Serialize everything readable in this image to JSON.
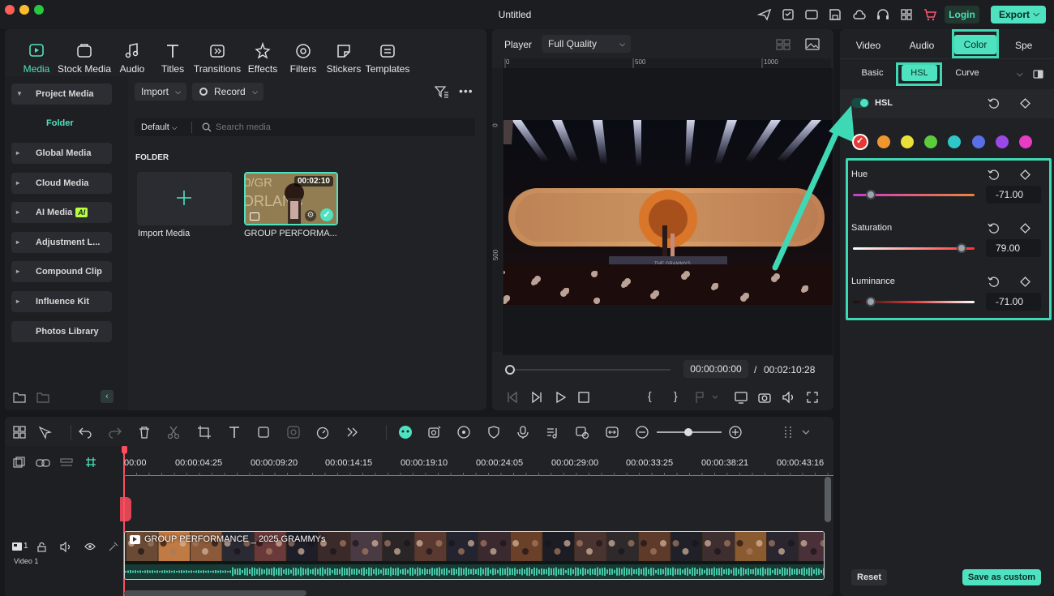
{
  "window": {
    "title": "Untitled",
    "login_label": "Login",
    "export_label": "Export"
  },
  "media_tabs": [
    {
      "label": "Media",
      "icon": "media-icon"
    },
    {
      "label": "Stock Media",
      "icon": "stock-media-icon"
    },
    {
      "label": "Audio",
      "icon": "audio-icon"
    },
    {
      "label": "Titles",
      "icon": "titles-icon"
    },
    {
      "label": "Transitions",
      "icon": "transitions-icon"
    },
    {
      "label": "Effects",
      "icon": "effects-icon"
    },
    {
      "label": "Filters",
      "icon": "filters-icon"
    },
    {
      "label": "Stickers",
      "icon": "stickers-icon"
    },
    {
      "label": "Templates",
      "icon": "templates-icon"
    }
  ],
  "sidebar": {
    "project_media": "Project Media",
    "folder": "Folder",
    "items": [
      "Global Media",
      "Cloud Media",
      "AI Media",
      "Adjustment L...",
      "Compound Clip",
      "Influence Kit"
    ],
    "ai_badge": "AI",
    "photos_library": "Photos Library"
  },
  "media_toolbar": {
    "import_label": "Import",
    "record_label": "Record",
    "sort_label": "Default",
    "search_placeholder": "Search media"
  },
  "media_grid": {
    "section": "FOLDER",
    "import_label": "Import Media",
    "clip": {
      "name": "GROUP PERFORMA...",
      "duration": "00:02:10",
      "thumb_text": "0/GR\nORLANC"
    }
  },
  "player": {
    "label": "Player",
    "quality": "Full Quality",
    "ruler_ticks": [
      "0",
      "500",
      "1000"
    ],
    "vruler_ticks": [
      "0",
      "500"
    ],
    "current_time": "00:00:00:00",
    "separator": "/",
    "total_time": "00:02:10:28",
    "stage_sign": "THE GRAMMYS"
  },
  "color_panel": {
    "top_tabs": [
      "Video",
      "Audio",
      "Color",
      "Spe"
    ],
    "active_top_tab": "Color",
    "sub_tabs": [
      "Basic",
      "HSL",
      "Curve"
    ],
    "active_sub_tab": "HSL",
    "hsl_label": "HSL",
    "hsl_enabled": true,
    "swatches": [
      "#e53935",
      "#f0962f",
      "#e9e13a",
      "#5ccb3c",
      "#2fc8c8",
      "#5a6fe6",
      "#9a49e6",
      "#e83cc4"
    ],
    "selected_swatch": "#e53935",
    "hue": {
      "label": "Hue",
      "value": "-71.00",
      "level": 0.145
    },
    "saturation": {
      "label": "Saturation",
      "value": "79.00",
      "level": 0.895
    },
    "luminance": {
      "label": "Luminance",
      "value": "-71.00",
      "level": 0.145
    },
    "reset_label": "Reset",
    "save_label": "Save as custom"
  },
  "timeline": {
    "ruler": [
      "00:00",
      "00:00:04:25",
      "00:00:09:20",
      "00:00:14:15",
      "00:00:19:10",
      "00:00:24:05",
      "00:00:29:00",
      "00:00:33:25",
      "00:00:38:21",
      "00:00:43:16"
    ],
    "track_number": "1",
    "track_name": "Video 1",
    "clip_title": "GROUP PERFORMANCE _ 2025 GRAMMYs"
  },
  "colors": {
    "accent": "#4fe2c0",
    "highlight_box": "#3fd8b4",
    "playhead": "#ff4d5e"
  }
}
